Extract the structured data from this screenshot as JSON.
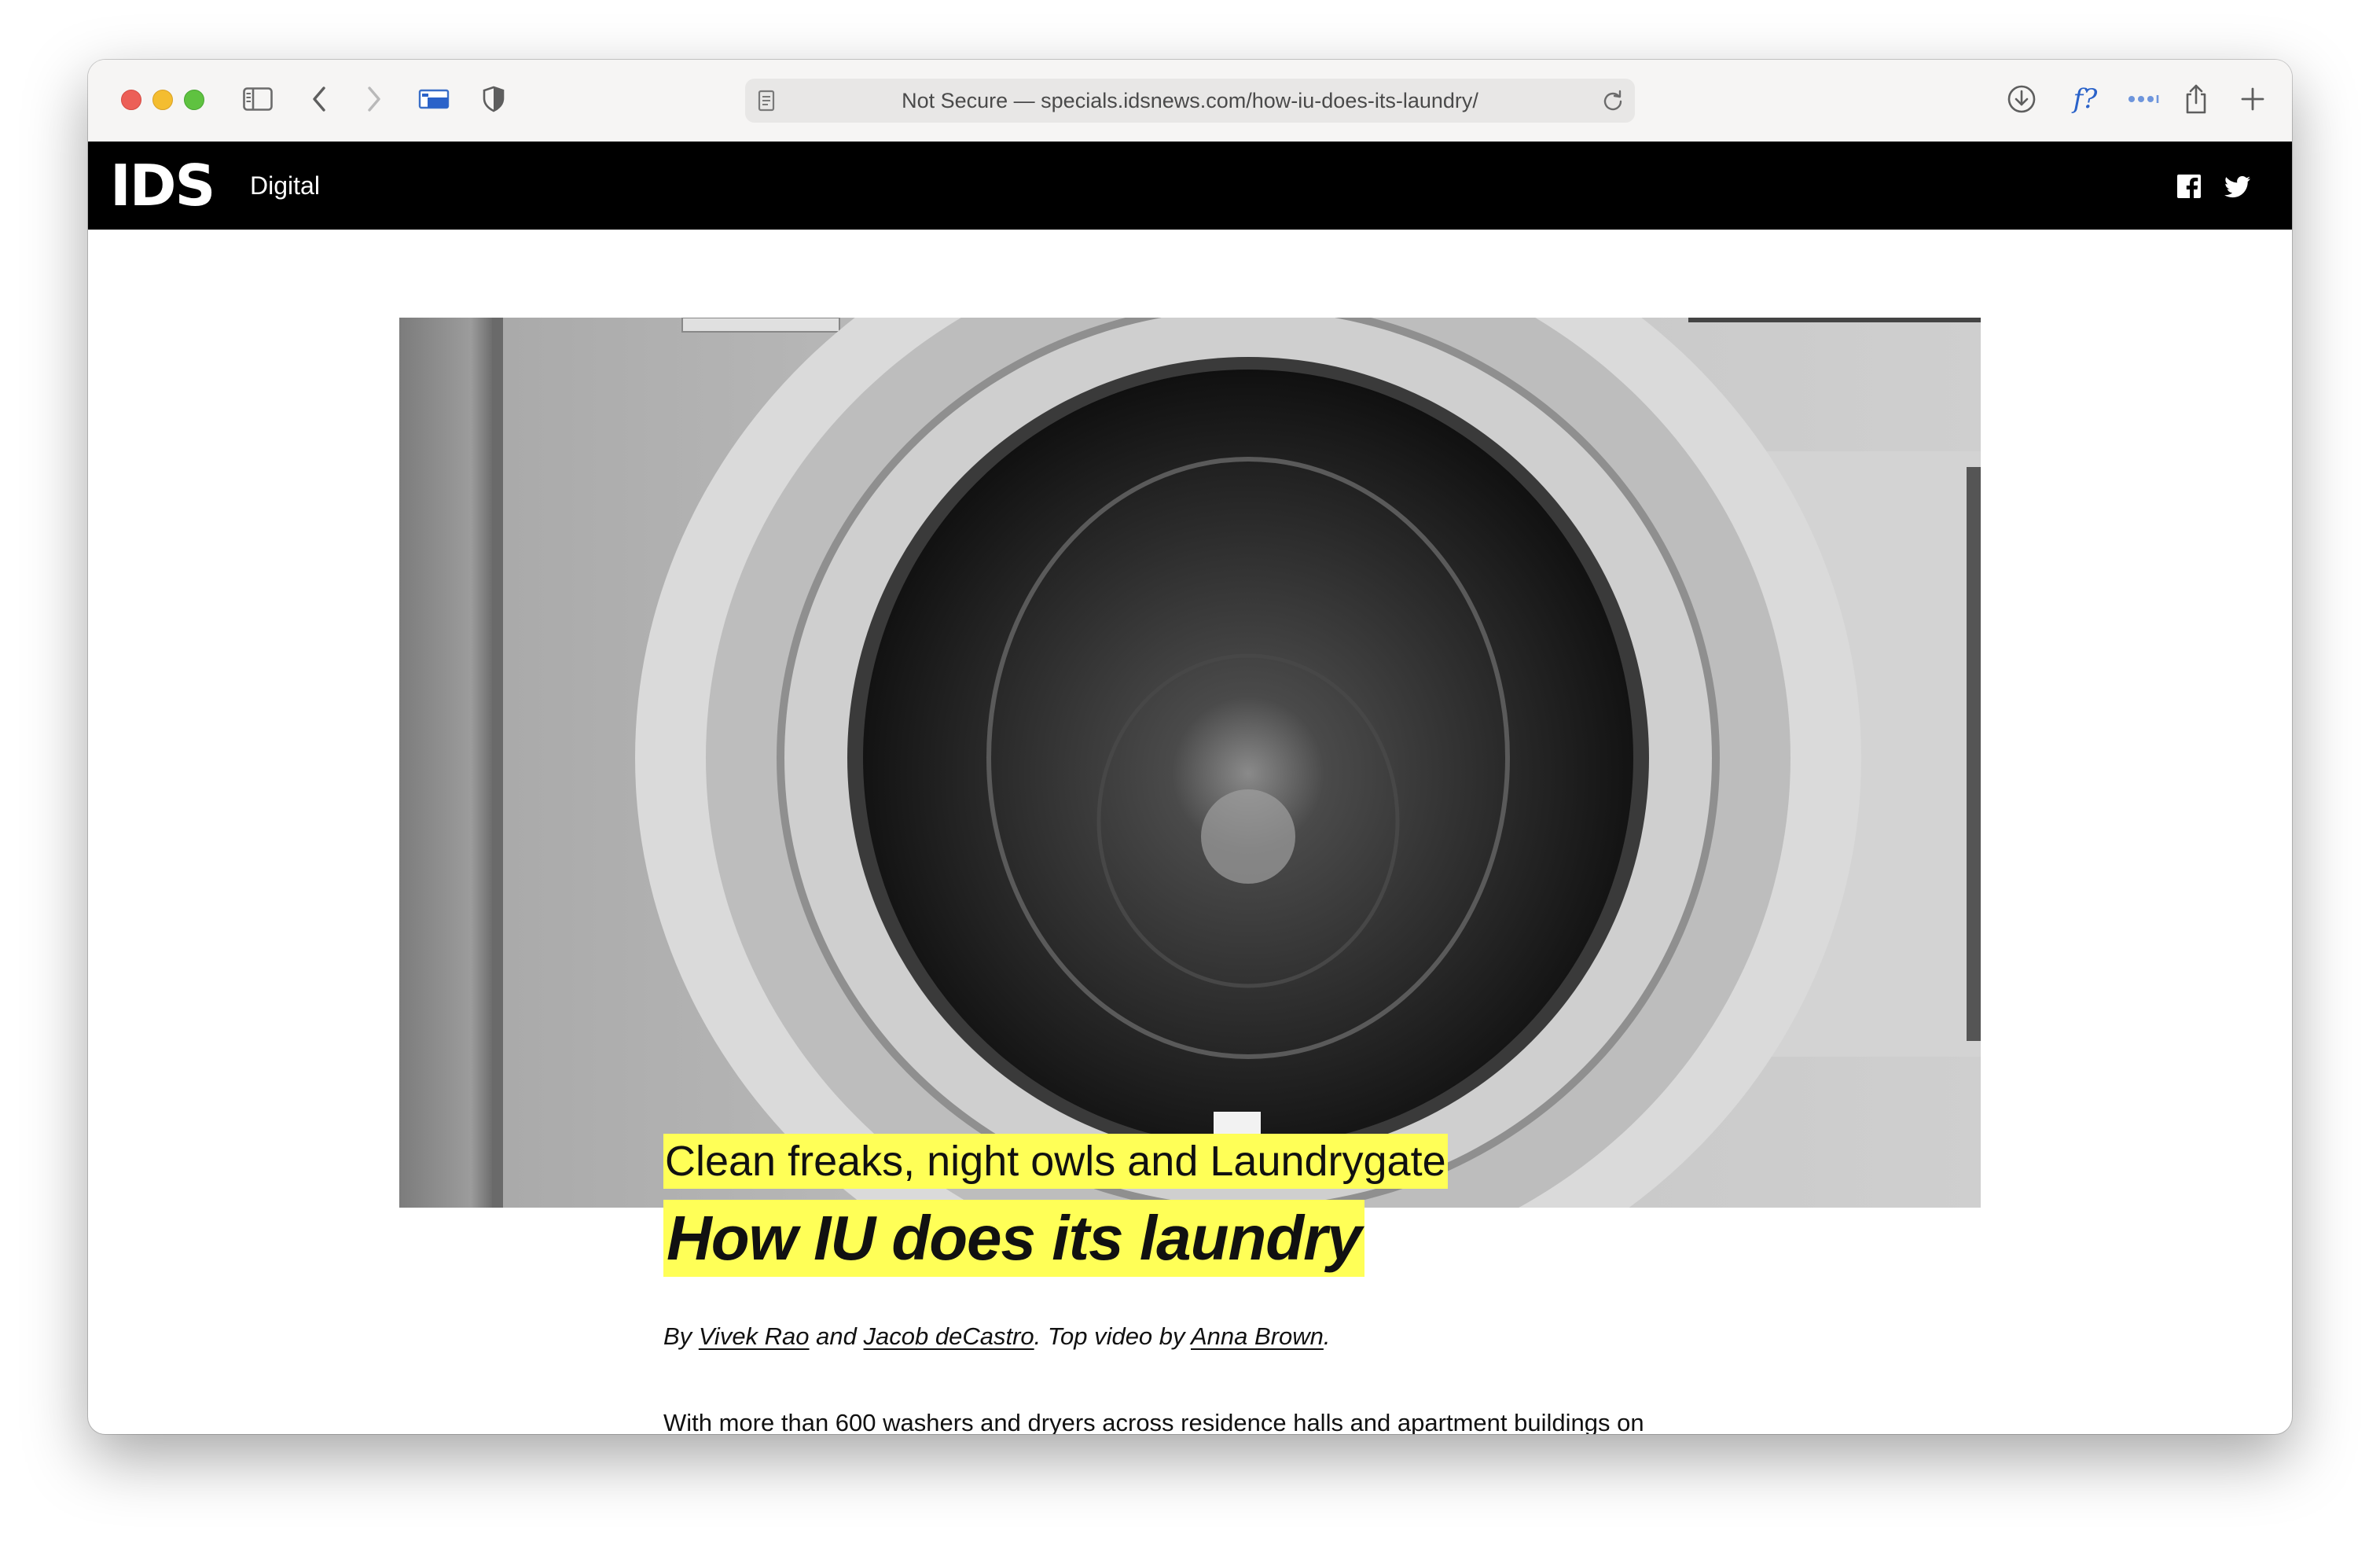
{
  "browser": {
    "url": "Not Secure — specials.idsnews.com/how-iu-does-its-laundry/",
    "icons": [
      "sidebar-icon",
      "back-icon",
      "forward-icon",
      "extension-icon",
      "privacy-shield-icon",
      "page-icon",
      "reload-icon",
      "download-icon",
      "font-extension-icon",
      "more-icon",
      "share-icon",
      "new-tab-icon"
    ],
    "font_extension_label": "f?"
  },
  "site": {
    "logo": "IDS",
    "section": "Digital",
    "social": [
      "facebook-icon",
      "twitter-icon"
    ],
    "brand_color": "#000000",
    "highlight_color": "#ffff57"
  },
  "article": {
    "kicker": "Clean freaks, night owls and Laundrygate",
    "headline": "How IU does its laundry",
    "byline": {
      "by": "By",
      "author1": "Vivek Rao",
      "and": "and",
      "author2": "Jacob deCastro",
      "video_prefix": ". Top video by",
      "video_author": "Anna Brown",
      "end": "."
    },
    "body_first_line": "With more than 600 washers and dryers across residence halls and apartment buildings on"
  }
}
